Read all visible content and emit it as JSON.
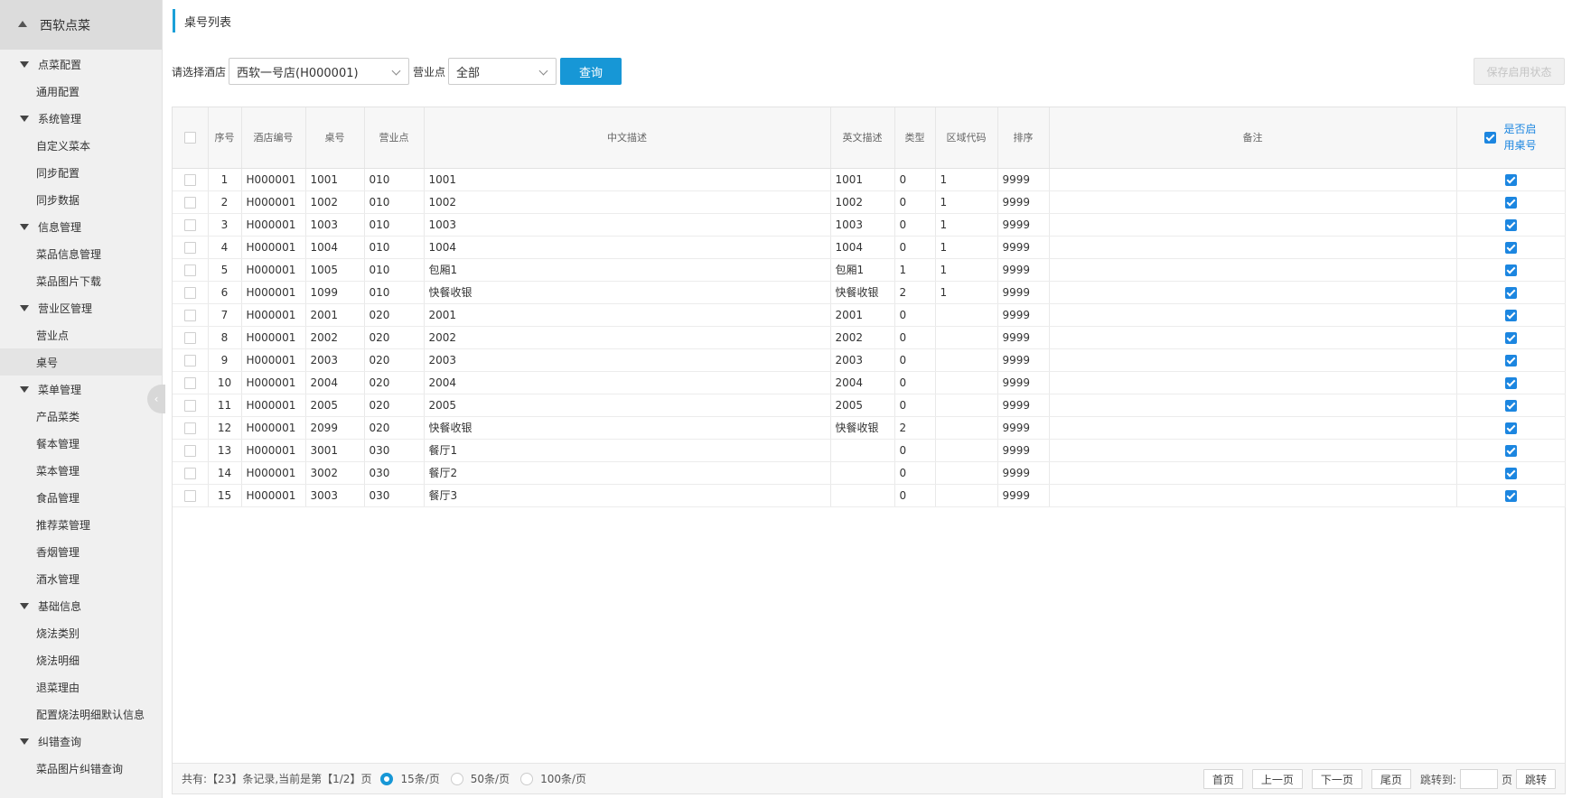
{
  "sidebar": {
    "brand": "西软点菜",
    "groups": [
      {
        "label": "点菜配置",
        "items": [
          "通用配置"
        ]
      },
      {
        "label": "系统管理",
        "items": [
          "自定义菜本",
          "同步配置",
          "同步数据"
        ]
      },
      {
        "label": "信息管理",
        "items": [
          "菜品信息管理",
          "菜品图片下载"
        ]
      },
      {
        "label": "营业区管理",
        "items": [
          "营业点",
          "桌号"
        ]
      },
      {
        "label": "菜单管理",
        "items": [
          "产品菜类",
          "餐本管理",
          "菜本管理",
          "食品管理",
          "推荐菜管理",
          "香烟管理",
          "酒水管理"
        ]
      },
      {
        "label": "基础信息",
        "items": [
          "烧法类别",
          "烧法明细",
          "退菜理由",
          "配置烧法明细默认信息"
        ]
      },
      {
        "label": "纠错查询",
        "items": [
          "菜品图片纠错查询"
        ]
      }
    ],
    "active_item": "桌号"
  },
  "page": {
    "title": "桌号列表"
  },
  "filters": {
    "hotel_label": "请选择酒店",
    "hotel_value": "西软一号店(H000001)",
    "outlet_label": "营业点",
    "outlet_value": "全部",
    "query_button": "查询",
    "save_button": "保存启用状态"
  },
  "table": {
    "columns": [
      "序号",
      "酒店编号",
      "桌号",
      "营业点",
      "中文描述",
      "英文描述",
      "类型",
      "区域代码",
      "排序",
      "备注"
    ],
    "enabled_header_line1": "是否启",
    "enabled_header_line2": "用桌号",
    "rows": [
      {
        "idx": "1",
        "hotel": "H000001",
        "table_no": "1001",
        "outlet": "010",
        "cn": "1001",
        "en": "1001",
        "type": "0",
        "area": "1",
        "sort": "9999",
        "remark": "",
        "enabled": true
      },
      {
        "idx": "2",
        "hotel": "H000001",
        "table_no": "1002",
        "outlet": "010",
        "cn": "1002",
        "en": "1002",
        "type": "0",
        "area": "1",
        "sort": "9999",
        "remark": "",
        "enabled": true
      },
      {
        "idx": "3",
        "hotel": "H000001",
        "table_no": "1003",
        "outlet": "010",
        "cn": "1003",
        "en": "1003",
        "type": "0",
        "area": "1",
        "sort": "9999",
        "remark": "",
        "enabled": true
      },
      {
        "idx": "4",
        "hotel": "H000001",
        "table_no": "1004",
        "outlet": "010",
        "cn": "1004",
        "en": "1004",
        "type": "0",
        "area": "1",
        "sort": "9999",
        "remark": "",
        "enabled": true
      },
      {
        "idx": "5",
        "hotel": "H000001",
        "table_no": "1005",
        "outlet": "010",
        "cn": "包厢1",
        "en": "包厢1",
        "type": "1",
        "area": "1",
        "sort": "9999",
        "remark": "",
        "enabled": true
      },
      {
        "idx": "6",
        "hotel": "H000001",
        "table_no": "1099",
        "outlet": "010",
        "cn": "快餐收银",
        "en": "快餐收银",
        "type": "2",
        "area": "1",
        "sort": "9999",
        "remark": "",
        "enabled": true
      },
      {
        "idx": "7",
        "hotel": "H000001",
        "table_no": "2001",
        "outlet": "020",
        "cn": "2001",
        "en": "2001",
        "type": "0",
        "area": "",
        "sort": "9999",
        "remark": "",
        "enabled": true
      },
      {
        "idx": "8",
        "hotel": "H000001",
        "table_no": "2002",
        "outlet": "020",
        "cn": "2002",
        "en": "2002",
        "type": "0",
        "area": "",
        "sort": "9999",
        "remark": "",
        "enabled": true
      },
      {
        "idx": "9",
        "hotel": "H000001",
        "table_no": "2003",
        "outlet": "020",
        "cn": "2003",
        "en": "2003",
        "type": "0",
        "area": "",
        "sort": "9999",
        "remark": "",
        "enabled": true
      },
      {
        "idx": "10",
        "hotel": "H000001",
        "table_no": "2004",
        "outlet": "020",
        "cn": "2004",
        "en": "2004",
        "type": "0",
        "area": "",
        "sort": "9999",
        "remark": "",
        "enabled": true
      },
      {
        "idx": "11",
        "hotel": "H000001",
        "table_no": "2005",
        "outlet": "020",
        "cn": "2005",
        "en": "2005",
        "type": "0",
        "area": "",
        "sort": "9999",
        "remark": "",
        "enabled": true
      },
      {
        "idx": "12",
        "hotel": "H000001",
        "table_no": "2099",
        "outlet": "020",
        "cn": "快餐收银",
        "en": "快餐收银",
        "type": "2",
        "area": "",
        "sort": "9999",
        "remark": "",
        "enabled": true
      },
      {
        "idx": "13",
        "hotel": "H000001",
        "table_no": "3001",
        "outlet": "030",
        "cn": "餐厅1",
        "en": "",
        "type": "0",
        "area": "",
        "sort": "9999",
        "remark": "",
        "enabled": true
      },
      {
        "idx": "14",
        "hotel": "H000001",
        "table_no": "3002",
        "outlet": "030",
        "cn": "餐厅2",
        "en": "",
        "type": "0",
        "area": "",
        "sort": "9999",
        "remark": "",
        "enabled": true
      },
      {
        "idx": "15",
        "hotel": "H000001",
        "table_no": "3003",
        "outlet": "030",
        "cn": "餐厅3",
        "en": "",
        "type": "0",
        "area": "",
        "sort": "9999",
        "remark": "",
        "enabled": true
      }
    ]
  },
  "pager": {
    "summary": "共有:【23】条记录,当前是第【1/2】页",
    "sizes": [
      {
        "label": "15条/页",
        "selected": true
      },
      {
        "label": "50条/页",
        "selected": false
      },
      {
        "label": "100条/页",
        "selected": false
      }
    ],
    "first": "首页",
    "prev": "上一页",
    "next": "下一页",
    "last": "尾页",
    "jump_label": "跳转到:",
    "page_unit": "页",
    "go": "跳转"
  },
  "colors": {
    "accent": "#1797d6",
    "checkbox": "#1c86e0",
    "sidebar_bg": "#f0f0f0"
  }
}
